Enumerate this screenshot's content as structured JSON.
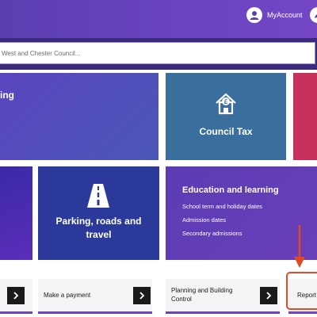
{
  "header": {
    "account_label": "MyAccount",
    "account_icon": "user-icon",
    "edit_icon": "pencil-icon"
  },
  "search": {
    "placeholder": "West and Chester Council..."
  },
  "tiles": {
    "housing": {
      "title": "ing"
    },
    "council_tax": {
      "title": "Council Tax",
      "icon": "house-pound-icon"
    },
    "parking": {
      "title_line1": "Parking, roads and",
      "title_line2": "travel",
      "icon": "road-icon"
    },
    "education": {
      "title": "Education and learning",
      "links": [
        "School term and holiday dates",
        "Admission dates",
        "Secondary admissions"
      ]
    }
  },
  "cards": {
    "make_payment": "Make a payment",
    "planning_line1": "Planning and Building",
    "planning_line2": "Control",
    "report": "Report"
  },
  "colors": {
    "header": "#6a44c2",
    "tile_blue": "#4a57b6",
    "council_tax": "#3a6e9c",
    "parking": "#2b3a9a",
    "education": "#5f3bb0",
    "pink": "#c8305c",
    "annotation": "#e04a25"
  }
}
